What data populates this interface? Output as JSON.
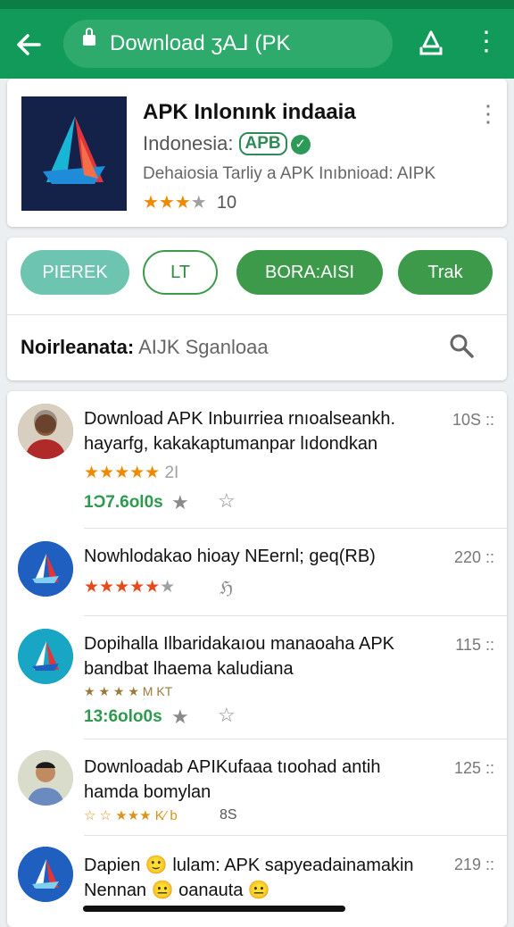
{
  "topbar": {
    "url": "Download ʒA⅃ (PK"
  },
  "app": {
    "title": "APK Inlonınk indaaia",
    "developer": "Indonesia:",
    "badge": "APB",
    "verified_mark": "✓",
    "description": "Dehaiosia Tarliy a APK Inıbnioad: AIPK",
    "stars_on": "★★★",
    "stars_off": "★",
    "rating_count": "10"
  },
  "actions": {
    "btn1": "PIEREK",
    "btn2": "LT",
    "btn3": "BORA:AISI",
    "btn4": "Trak"
  },
  "search": {
    "label": "Noirleanata:",
    "query": "AIJK Sganloaa"
  },
  "list": [
    {
      "title": "Download APK Inbuırriea rnıoalseankh.",
      "subtitle": "hayarfg, kakakaptumanpar lıdondkan",
      "meta": "10S ::",
      "stars_on": "★★★★★",
      "stars_extra": "2Ι",
      "size": "1Ͻ7.6ol0s"
    },
    {
      "title": "Nowhlodakao hioay NEernl; geq(RB)",
      "meta": "220 ::",
      "stars_on": "★★★★★",
      "stars_off": "★",
      "tail": "ℌ"
    },
    {
      "title": "Dopihalla Ilbaridakaıou manaoaha APK",
      "subtitle": "bandbat lhaema kaludiana",
      "meta": "115 ::",
      "stars_small": "★ ★ ★ ★ M KT",
      "size": "13:6olo0s"
    },
    {
      "title": "Downloadab APIKufaaa tıoohad antih",
      "subtitle": "hamda bomylan",
      "meta": "125 ::",
      "stars_small": "☆ ☆ ★★★ K⁄ b",
      "tail": "8S"
    },
    {
      "title": "Dapien 🙂 lulam: APK sapyeadainamakin",
      "subtitle": "Nennan 😐 oanauta 😐",
      "meta": "219 ::"
    }
  ]
}
